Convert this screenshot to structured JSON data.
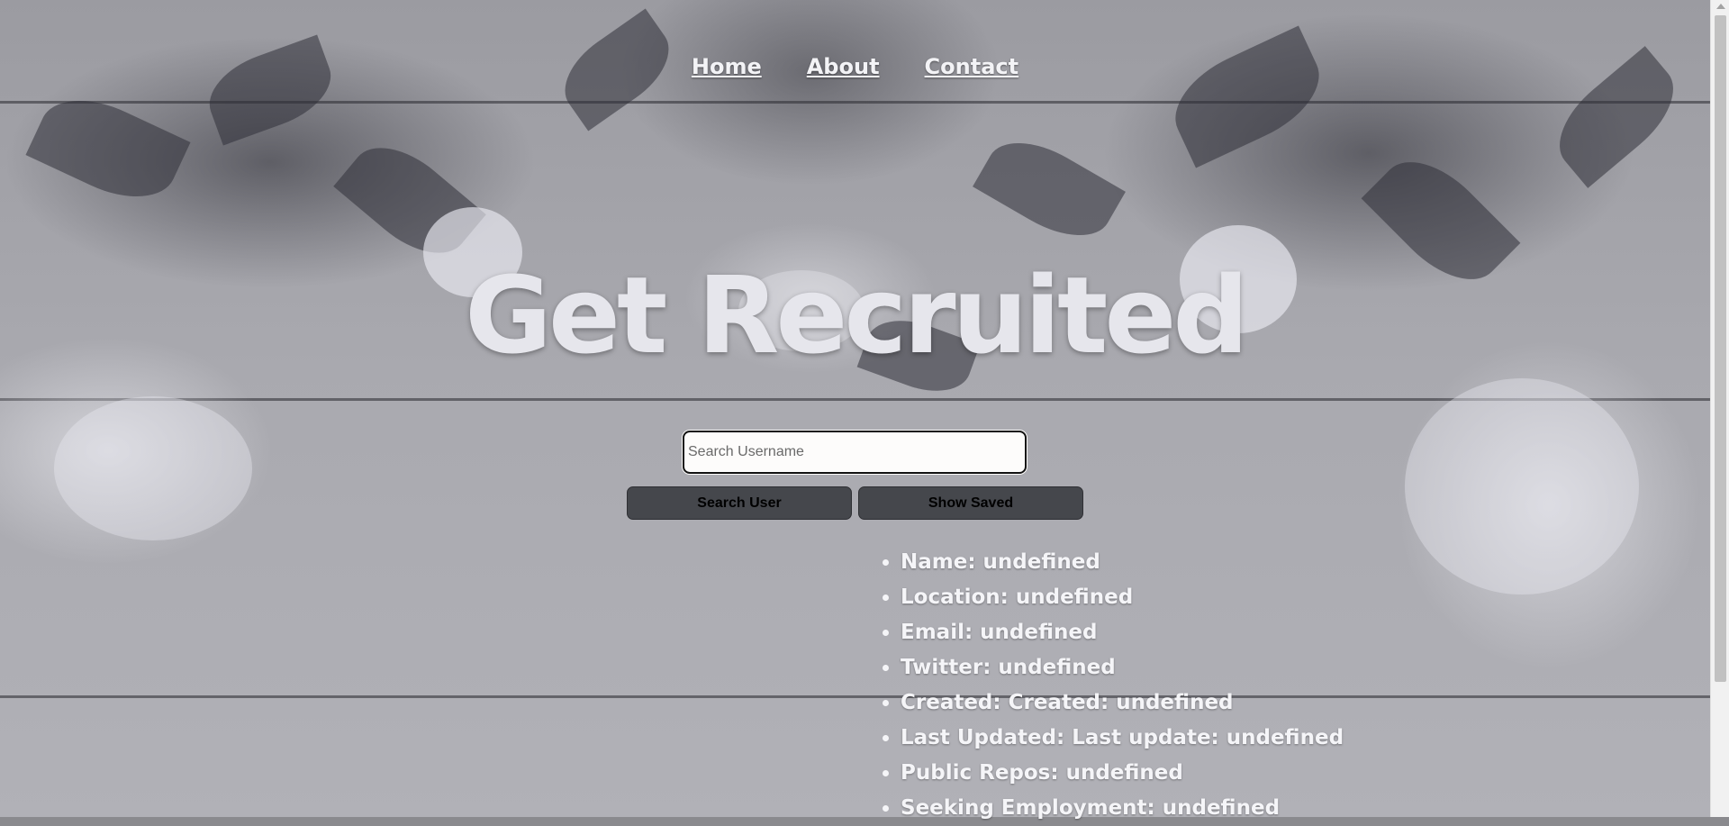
{
  "nav": {
    "home": "Home",
    "about": "About",
    "contact": "Contact"
  },
  "header": {
    "title": "Get Recruited"
  },
  "search": {
    "placeholder": "Search Username",
    "value": "",
    "search_button": "Search User",
    "saved_button": "Show Saved"
  },
  "profile": {
    "items": [
      "Name: undefined",
      "Location: undefined",
      "Email: undefined",
      "Twitter: undefined",
      "Created: Created: undefined",
      "Last Updated: Last update: undefined",
      "Public Repos: undefined",
      "Seeking Employment: undefined"
    ]
  },
  "icons": {
    "list_bullet": "disc-bullet-icon",
    "scroll_up": "chevron-up-icon"
  },
  "colors": {
    "button_bg": "#45474c",
    "text_light": "#f5f5f8",
    "input_bg": "#fdfcfb"
  }
}
